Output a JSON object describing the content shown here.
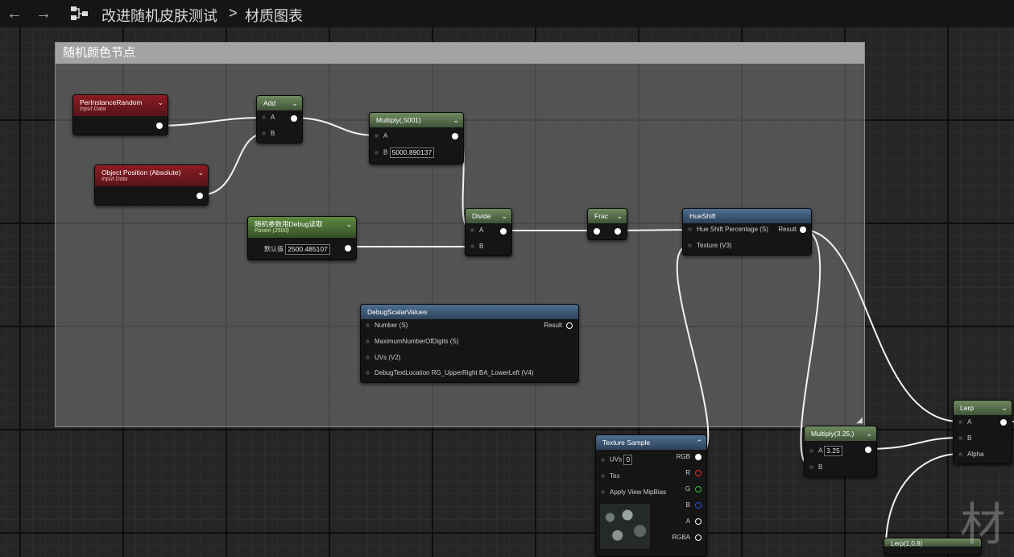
{
  "topbar": {
    "back": "←",
    "forward": "→",
    "asset_name": "改进随机皮肤测试",
    "separator": ">",
    "graph_name": "材质图表"
  },
  "comment": {
    "title": "随机颜色节点"
  },
  "nodes": {
    "per_instance_random": {
      "title": "PerInstanceRandom",
      "subtitle": "Input Data"
    },
    "object_position": {
      "title": "Object Position (Absolute)",
      "subtitle": "Input Data"
    },
    "add": {
      "title": "Add",
      "a": "A",
      "b": "B"
    },
    "multiply1": {
      "title": "Multiply(,5001)",
      "a": "A",
      "b": "B",
      "b_value": "5000.890137"
    },
    "debug_param": {
      "title": "随机参数用Debug读取",
      "subtitle": "Param (2500)",
      "default_label": "默认值",
      "default_value": "2500.485107"
    },
    "divide": {
      "title": "Divide",
      "a": "A",
      "b": "B"
    },
    "frac": {
      "title": "Frac"
    },
    "hueshift": {
      "title": "HueShift",
      "in1": "Hue Shift Percentage (S)",
      "in2": "Texture (V3)",
      "out": "Result"
    },
    "debug_scalar": {
      "title": "DebugScalarValues",
      "in1": "Number (S)",
      "in2": "MaximumNumberOfDigits (S)",
      "in3": "UVs (V2)",
      "in4": "DebugTextLocation RG_UpperRight BA_LowerLeft (V4)",
      "out": "Result"
    },
    "texture_sample": {
      "title": "Texture Sample",
      "uvs": "UVs",
      "uvs_value": "0",
      "tex": "Tex",
      "mip": "Apply View MipBias",
      "rgb": "RGB",
      "r": "R",
      "g": "G",
      "b": "B",
      "a": "A",
      "rgba": "RGBA"
    },
    "multiply2": {
      "title": "Multiply(3.25,)",
      "a": "A",
      "a_value": "3.25",
      "b": "B"
    },
    "lerp": {
      "title": "Lerp",
      "a": "A",
      "b": "B",
      "alpha": "Alpha"
    },
    "lerp2": {
      "title": "Lerp(1,0.8)"
    }
  },
  "watermark": "材",
  "colors": {
    "input_header": "#8c1c22",
    "math_header": "#6f8a60",
    "param_header": "#5f8a40",
    "function_header": "#4f6f92",
    "pin_r": "#e03030",
    "pin_g": "#30c040",
    "pin_b": "#3050e0"
  }
}
